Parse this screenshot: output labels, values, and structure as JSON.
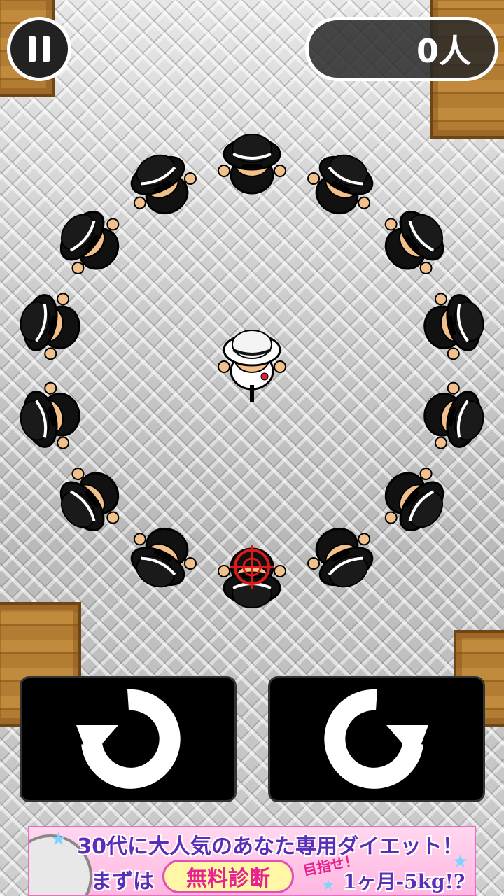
{
  "hud": {
    "pause_icon": "pause-icon",
    "score_text": "0人"
  },
  "arena": {
    "boss": {
      "hat_color": "#ffffff",
      "suit_color": "#ffffff"
    },
    "guards_count": 14,
    "target_guard_index": 7,
    "guard_color": "#111111",
    "skin_color": "#f2c08a",
    "crosshair_color": "#e01818"
  },
  "controls": {
    "rotate_left_icon": "rotate-counterclockwise-icon",
    "rotate_right_icon": "rotate-clockwise-icon"
  },
  "ad": {
    "line1": "30代に大人気のあなた専用ダイエット！",
    "line2_left": "まずは",
    "pill": "無料診断",
    "slant": "目指せ！",
    "line2_right": "1ヶ月-5kg!?",
    "accent_color": "#5a2eb8",
    "pink_color": "#e7218f"
  }
}
